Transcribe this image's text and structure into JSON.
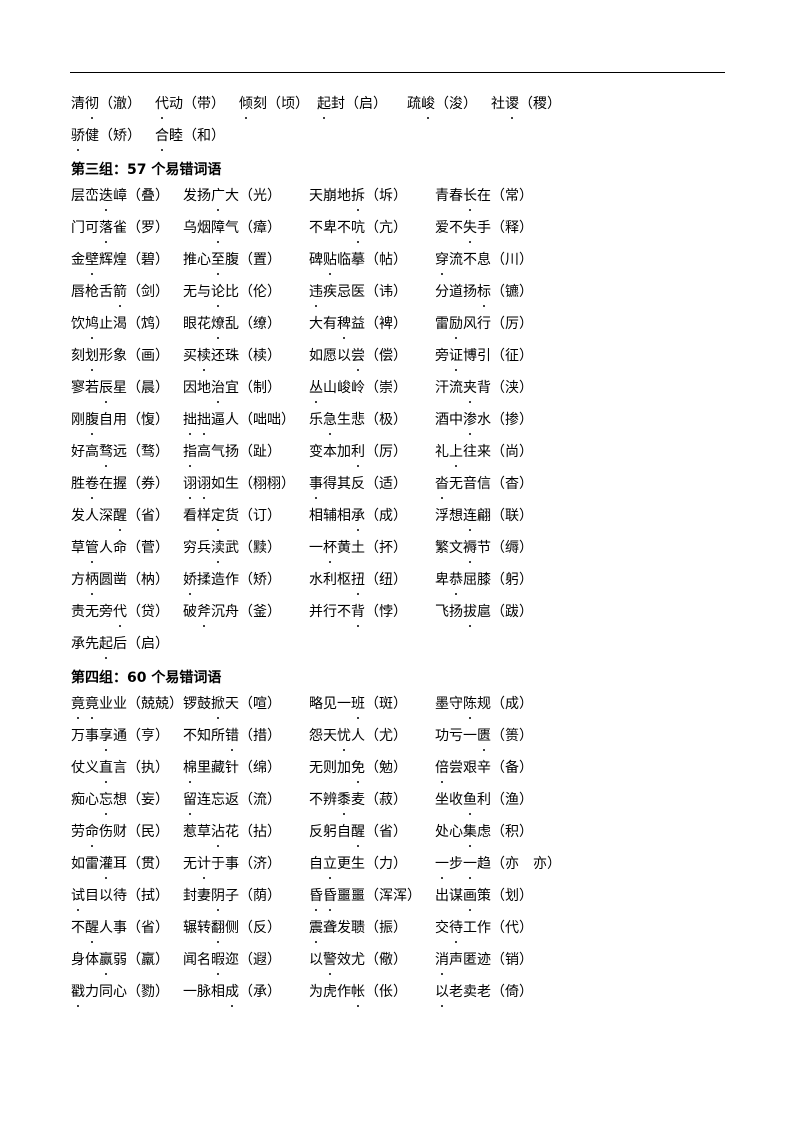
{
  "top_rows": [
    [
      {
        "word": "清彻",
        "dots": [
          1
        ],
        "fix": "澈"
      },
      {
        "word": "代动",
        "dots": [
          0
        ],
        "fix": "带"
      },
      {
        "word": "倾刻",
        "dots": [
          0
        ],
        "fix": "顷"
      },
      {
        "word": "起封",
        "dots": [
          0
        ],
        "fix": "启"
      },
      {
        "word": "疏峻",
        "dots": [
          1
        ],
        "fix": "浚"
      },
      {
        "word": "社谡",
        "dots": [
          1
        ],
        "fix": "稷"
      }
    ],
    [
      {
        "word": "骄健",
        "dots": [
          0
        ],
        "fix": "矫"
      },
      {
        "word": "合睦",
        "dots": [
          0
        ],
        "fix": "和"
      }
    ]
  ],
  "groups": [
    {
      "heading": "第三组：57 个易错词语",
      "rows": [
        [
          {
            "word": "层峦迭嶂",
            "dots": [
              2
            ],
            "fix": "叠"
          },
          {
            "word": "发扬广大",
            "dots": [
              2
            ],
            "fix": "光"
          },
          {
            "word": "天崩地拆",
            "dots": [
              3
            ],
            "fix": "坼"
          },
          {
            "word": "青春长在",
            "dots": [
              2
            ],
            "fix": "常"
          }
        ],
        [
          {
            "word": "门可落雀",
            "dots": [
              2
            ],
            "fix": "罗"
          },
          {
            "word": "乌烟障气",
            "dots": [
              2
            ],
            "fix": "瘴"
          },
          {
            "word": "不卑不吭",
            "dots": [
              3
            ],
            "fix": "亢"
          },
          {
            "word": "爱不失手",
            "dots": [
              2
            ],
            "fix": "释"
          }
        ],
        [
          {
            "word": "金壁辉煌",
            "dots": [
              1
            ],
            "fix": "碧"
          },
          {
            "word": "推心至腹",
            "dots": [
              2
            ],
            "fix": "置"
          },
          {
            "word": "碑贴临摹",
            "dots": [
              1
            ],
            "fix": "帖"
          },
          {
            "word": "穿流不息",
            "dots": [
              0
            ],
            "fix": "川"
          }
        ],
        [
          {
            "word": "唇枪舌箭",
            "dots": [
              3
            ],
            "fix": "剑"
          },
          {
            "word": "无与论比",
            "dots": [
              2
            ],
            "fix": "伦"
          },
          {
            "word": "违疾忌医",
            "dots": [
              0
            ],
            "fix": "讳"
          },
          {
            "word": "分道扬标",
            "dots": [
              3
            ],
            "fix": "镳"
          }
        ],
        [
          {
            "word": "饮鸠止渴",
            "dots": [
              1
            ],
            "fix": "鸩"
          },
          {
            "word": "眼花燎乱",
            "dots": [
              2
            ],
            "fix": "缭"
          },
          {
            "word": "大有稗益",
            "dots": [
              2
            ],
            "fix": "裨"
          },
          {
            "word": "雷励风行",
            "dots": [
              1
            ],
            "fix": "厉"
          }
        ],
        [
          {
            "word": "刻划形象",
            "dots": [
              1
            ],
            "fix": "画"
          },
          {
            "word": "买椟还珠",
            "dots": [
              1
            ],
            "fix": "椟"
          },
          {
            "word": "如愿以尝",
            "dots": [
              3
            ],
            "fix": "偿"
          },
          {
            "word": "旁证博引",
            "dots": [
              1
            ],
            "fix": "征"
          }
        ],
        [
          {
            "word": "寥若辰星",
            "dots": [
              2
            ],
            "fix": "晨"
          },
          {
            "word": "因地治宜",
            "dots": [
              2
            ],
            "fix": "制"
          },
          {
            "word": "丛山峻岭",
            "dots": [
              0
            ],
            "fix": "崇"
          },
          {
            "word": "汗流夹背",
            "dots": [
              2
            ],
            "fix": "浃"
          }
        ],
        [
          {
            "word": "刚腹自用",
            "dots": [
              1
            ],
            "fix": "愎"
          },
          {
            "word": "拙拙逼人",
            "dots": [
              0,
              1
            ],
            "fix": "咄咄"
          },
          {
            "word": "乐急生悲",
            "dots": [
              1
            ],
            "fix": "极"
          },
          {
            "word": "酒中渗水",
            "dots": [
              2
            ],
            "fix": "掺"
          }
        ],
        [
          {
            "word": "好高骛远",
            "dots": [
              2
            ],
            "fix": "骛"
          },
          {
            "word": "指高气扬",
            "dots": [
              0
            ],
            "fix": "趾"
          },
          {
            "word": "变本加利",
            "dots": [
              3
            ],
            "fix": "厉"
          },
          {
            "word": "礼上往来",
            "dots": [
              1
            ],
            "fix": "尚"
          }
        ],
        [
          {
            "word": "胜卷在握",
            "dots": [
              1
            ],
            "fix": "券"
          },
          {
            "word": "诩诩如生",
            "dots": [
              0,
              1
            ],
            "fix": "栩栩"
          },
          {
            "word": "事得其反",
            "dots": [
              0
            ],
            "fix": "适"
          },
          {
            "word": "沓无音信",
            "dots": [
              0
            ],
            "fix": "杳"
          }
        ],
        [
          {
            "word": "发人深醒",
            "dots": [
              3
            ],
            "fix": "省"
          },
          {
            "word": "看样定货",
            "dots": [
              2
            ],
            "fix": "订"
          },
          {
            "word": "相辅相承",
            "dots": [
              3
            ],
            "fix": "成"
          },
          {
            "word": "浮想连翩",
            "dots": [
              2
            ],
            "fix": "联"
          }
        ],
        [
          {
            "word": "草管人命",
            "dots": [
              1
            ],
            "fix": "菅"
          },
          {
            "word": "穷兵渎武",
            "dots": [
              2
            ],
            "fix": "黩"
          },
          {
            "word": "一杯黄土",
            "dots": [
              1
            ],
            "fix": "抔"
          },
          {
            "word": "繁文褥节",
            "dots": [
              2
            ],
            "fix": "缛"
          }
        ],
        [
          {
            "word": "方柄圆凿",
            "dots": [
              1
            ],
            "fix": "枘"
          },
          {
            "word": "娇揉造作",
            "dots": [
              0
            ],
            "fix": "矫"
          },
          {
            "word": "水利枢扭",
            "dots": [
              3
            ],
            "fix": "纽"
          },
          {
            "word": "卑恭屈膝",
            "dots": [
              1
            ],
            "fix": "躬"
          }
        ],
        [
          {
            "word": "责无旁代",
            "dots": [
              3
            ],
            "fix": "贷"
          },
          {
            "word": "破斧沉舟",
            "dots": [
              1
            ],
            "fix": "釜"
          },
          {
            "word": "并行不背",
            "dots": [
              3
            ],
            "fix": "悖"
          },
          {
            "word": "飞扬拔扈",
            "dots": [
              2
            ],
            "fix": "跋"
          }
        ],
        [
          {
            "word": "承先起后",
            "dots": [
              2
            ],
            "fix": "启"
          }
        ]
      ]
    },
    {
      "heading": "第四组：60 个易错词语",
      "rows": [
        [
          {
            "word": "竟竟业业",
            "dots": [
              0,
              1
            ],
            "fix": "兢兢"
          },
          {
            "word": "锣鼓掀天",
            "dots": [
              2
            ],
            "fix": "喧"
          },
          {
            "word": "略见一班",
            "dots": [
              3
            ],
            "fix": "斑"
          },
          {
            "word": "墨守陈规",
            "dots": [
              2
            ],
            "fix": "成"
          }
        ],
        [
          {
            "word": "万事享通",
            "dots": [
              2
            ],
            "fix": "亨"
          },
          {
            "word": "不知所错",
            "dots": [
              3
            ],
            "fix": "措"
          },
          {
            "word": "怨天忧人",
            "dots": [
              2
            ],
            "fix": "尤"
          },
          {
            "word": "功亏一匮",
            "dots": [
              3
            ],
            "fix": "篑"
          }
        ],
        [
          {
            "word": "仗义直言",
            "dots": [
              2
            ],
            "fix": "执"
          },
          {
            "word": "棉里藏针",
            "dots": [
              0
            ],
            "fix": "绵"
          },
          {
            "word": "无则加免",
            "dots": [
              3
            ],
            "fix": "勉"
          },
          {
            "word": "倍尝艰辛",
            "dots": [
              0
            ],
            "fix": "备"
          }
        ],
        [
          {
            "word": "痴心忘想",
            "dots": [
              2
            ],
            "fix": "妄"
          },
          {
            "word": "留连忘返",
            "dots": [
              0
            ],
            "fix": "流"
          },
          {
            "word": "不辨黍麦",
            "dots": [
              2
            ],
            "fix": "菽"
          },
          {
            "word": "坐收鱼利",
            "dots": [
              2
            ],
            "fix": "渔"
          }
        ],
        [
          {
            "word": "劳命伤财",
            "dots": [
              1
            ],
            "fix": "民"
          },
          {
            "word": "惹草沾花",
            "dots": [
              2
            ],
            "fix": "拈"
          },
          {
            "word": "反躬自醒",
            "dots": [
              3
            ],
            "fix": "省"
          },
          {
            "word": "处心集虑",
            "dots": [
              2
            ],
            "fix": "积"
          }
        ],
        [
          {
            "word": "如雷灌耳",
            "dots": [
              2
            ],
            "fix": "贯"
          },
          {
            "word": "无计于事",
            "dots": [
              1
            ],
            "fix": "济"
          },
          {
            "word": "自立更生",
            "dots": [
              1
            ],
            "fix": "力"
          },
          {
            "word": "一步一趋",
            "dots": [
              0,
              2
            ],
            "fix": "亦　亦"
          }
        ],
        [
          {
            "word": "试目以待",
            "dots": [
              0
            ],
            "fix": "拭"
          },
          {
            "word": "封妻阴子",
            "dots": [
              2
            ],
            "fix": "荫"
          },
          {
            "word": "昏昏噩噩",
            "dots": [
              0,
              1
            ],
            "fix": "浑浑"
          },
          {
            "word": "出谋画策",
            "dots": [
              2
            ],
            "fix": "划"
          }
        ],
        [
          {
            "word": "不醒人事",
            "dots": [
              1
            ],
            "fix": "省"
          },
          {
            "word": "辗转翻侧",
            "dots": [
              2
            ],
            "fix": "反"
          },
          {
            "word": "震聋发聩",
            "dots": [
              0
            ],
            "fix": "振"
          },
          {
            "word": "交待工作",
            "dots": [
              1
            ],
            "fix": "代"
          }
        ],
        [
          {
            "word": "身体赢弱",
            "dots": [
              2
            ],
            "fix": "羸"
          },
          {
            "word": "闻名暇迩",
            "dots": [
              2
            ],
            "fix": "遐"
          },
          {
            "word": "以警效尤",
            "dots": [
              1
            ],
            "fix": "儆"
          },
          {
            "word": "消声匿迹",
            "dots": [
              0
            ],
            "fix": "销"
          }
        ],
        [
          {
            "word": "戳力同心",
            "dots": [
              0
            ],
            "fix": "勠"
          },
          {
            "word": "一脉相成",
            "dots": [
              3
            ],
            "fix": "承"
          },
          {
            "word": "为虎作帐",
            "dots": [
              3
            ],
            "fix": "伥"
          },
          {
            "word": "以老卖老",
            "dots": [
              0
            ],
            "fix": "倚"
          }
        ]
      ]
    }
  ]
}
